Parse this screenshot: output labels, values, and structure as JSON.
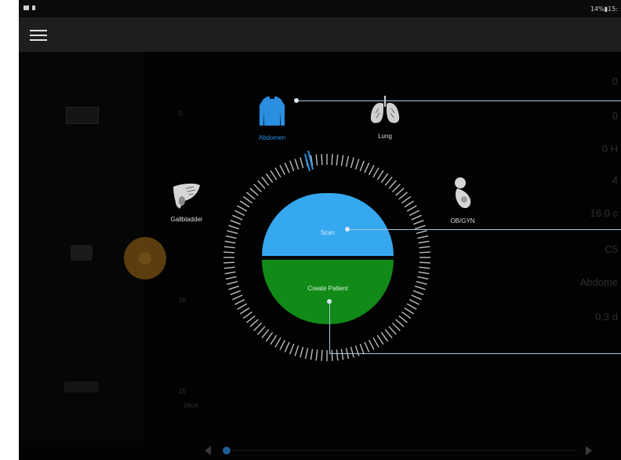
{
  "status_bar": {
    "right_text": "14%▮15:"
  },
  "app_bar": {
    "menu_icon": "hamburger-menu-icon"
  },
  "presets": [
    {
      "label": "Abdomen",
      "icon": "abdomen-torso-icon",
      "selected": true
    },
    {
      "label": "Lung",
      "icon": "lungs-icon",
      "selected": false
    },
    {
      "label": "Gallbladder",
      "icon": "gallbladder-liver-icon",
      "selected": false
    },
    {
      "label": "OB/GYN",
      "icon": "fetus-icon",
      "selected": false
    }
  ],
  "dial": {
    "scan_label": "Scan",
    "create_patient_label": "Create Patient",
    "colors": {
      "scan": "#35a8ef",
      "create_patient": "#118a18",
      "selected": "#2a8fe0"
    }
  },
  "background": {
    "depth_ticks": [
      "0",
      "10",
      "15",
      "16cm"
    ],
    "right_values": [
      "0",
      "0",
      "0 H",
      "4",
      "16.0 c",
      "C5",
      "Abdome",
      "0.3 d"
    ]
  }
}
